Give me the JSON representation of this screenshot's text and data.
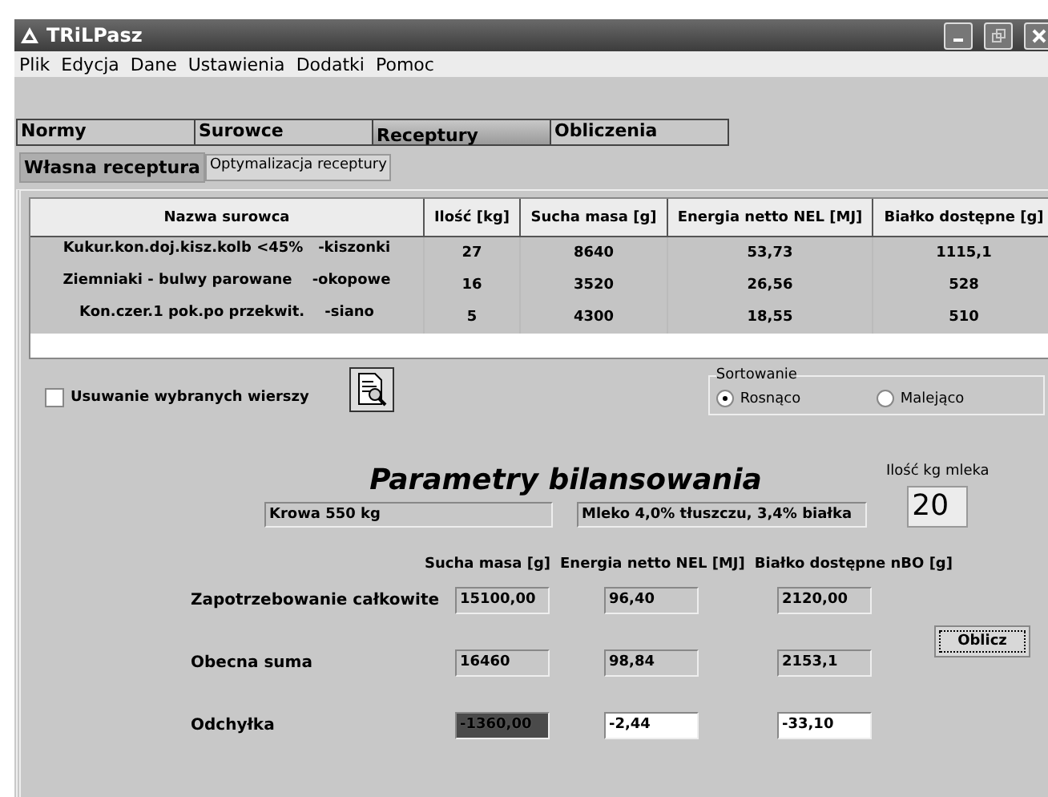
{
  "window": {
    "title": "TRiLPasz"
  },
  "menu": [
    "Plik",
    "Edycja",
    "Dane",
    "Ustawienia",
    "Dodatki",
    "Pomoc"
  ],
  "tabs": [
    {
      "label": "Normy",
      "selected": false
    },
    {
      "label": "Surowce",
      "selected": false
    },
    {
      "label": "Receptury",
      "selected": true
    },
    {
      "label": "Obliczenia",
      "selected": false
    }
  ],
  "subtabs": [
    {
      "label": "Własna receptura",
      "selected": true
    },
    {
      "label": "Optymalizacja receptury",
      "selected": false
    }
  ],
  "table": {
    "columns": [
      "Nazwa surowca",
      "Ilość [kg]",
      "Sucha masa [g]",
      "Energia netto NEL [MJ]",
      "Białko dostępne [g]"
    ],
    "rows": [
      [
        "Kukur.kon.doj.kisz.kolb <45%   -kiszonki",
        "27",
        "8640",
        "53,73",
        "1115,1"
      ],
      [
        "Ziemniaki - bulwy parowane    -okopowe",
        "16",
        "3520",
        "26,56",
        "528"
      ],
      [
        "Kon.czer.1 pok.po przekwit.    -siano",
        "5",
        "4300",
        "18,55",
        "510"
      ]
    ]
  },
  "delete_selected": {
    "label": "Usuwanie wybranych wierszy",
    "checked": false
  },
  "sorting": {
    "title": "Sortowanie",
    "options": [
      {
        "label": "Rosnąco",
        "selected": true
      },
      {
        "label": "Malejąco",
        "selected": false
      }
    ]
  },
  "balance": {
    "title": "Parametry bilansowania",
    "animal": "Krowa 550 kg",
    "milk": "Mleko 4,0% tłuszczu, 3,4% białka",
    "milk_kg_label": "Ilość kg mleka",
    "milk_kg": "20",
    "columns": [
      "Sucha masa [g]",
      "Energia netto NEL [MJ]",
      "Białko dostępne nBO [g]"
    ],
    "rows": [
      {
        "label": "Zapotrzebowanie całkowite",
        "kind": "readonly",
        "cells": [
          {
            "value": "15100,00",
            "highlighted": false
          },
          {
            "value": "96,40",
            "highlighted": false
          },
          {
            "value": "2120,00",
            "highlighted": false
          }
        ]
      },
      {
        "label": "Obecna suma",
        "kind": "readonly",
        "cells": [
          {
            "value": "16460",
            "highlighted": false
          },
          {
            "value": "98,84",
            "highlighted": false
          },
          {
            "value": "2153,1",
            "highlighted": false
          }
        ]
      },
      {
        "label": "Odchyłka",
        "kind": "result",
        "cells": [
          {
            "value": "-1360,00",
            "highlighted": true
          },
          {
            "value": "-2,44",
            "highlighted": false
          },
          {
            "value": "-33,10",
            "highlighted": false
          }
        ]
      }
    ],
    "button": "Oblicz"
  }
}
